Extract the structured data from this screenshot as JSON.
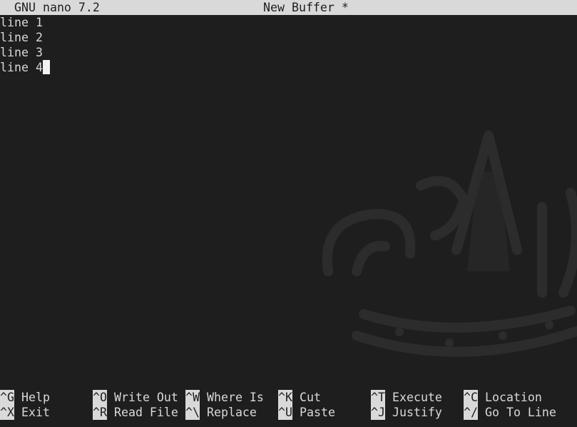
{
  "title_bar": {
    "app_name": "GNU nano 7.2",
    "buffer_name": "New Buffer *"
  },
  "editor": {
    "lines": [
      "line 1",
      "line 2",
      "line 3",
      "line 4"
    ]
  },
  "shortcuts": {
    "row1": [
      {
        "key": "^G",
        "label": "Help"
      },
      {
        "key": "^O",
        "label": "Write Out"
      },
      {
        "key": "^W",
        "label": "Where Is"
      },
      {
        "key": "^K",
        "label": "Cut"
      },
      {
        "key": "^T",
        "label": "Execute"
      },
      {
        "key": "^C",
        "label": "Location"
      }
    ],
    "row2": [
      {
        "key": "^X",
        "label": "Exit"
      },
      {
        "key": "^R",
        "label": "Read File"
      },
      {
        "key": "^\\",
        "label": "Replace"
      },
      {
        "key": "^U",
        "label": "Paste"
      },
      {
        "key": "^J",
        "label": "Justify"
      },
      {
        "key": "^/",
        "label": "Go To Line"
      }
    ]
  },
  "colors": {
    "background": "#1e1e1f",
    "foreground": "#d9d9d9",
    "inverse_bg": "#d9d9d9",
    "cursor": "#f2f2f2",
    "logo": "#2b2b2c"
  },
  "icons": {
    "background_logo": "kali-dragon-crown-watermark"
  }
}
